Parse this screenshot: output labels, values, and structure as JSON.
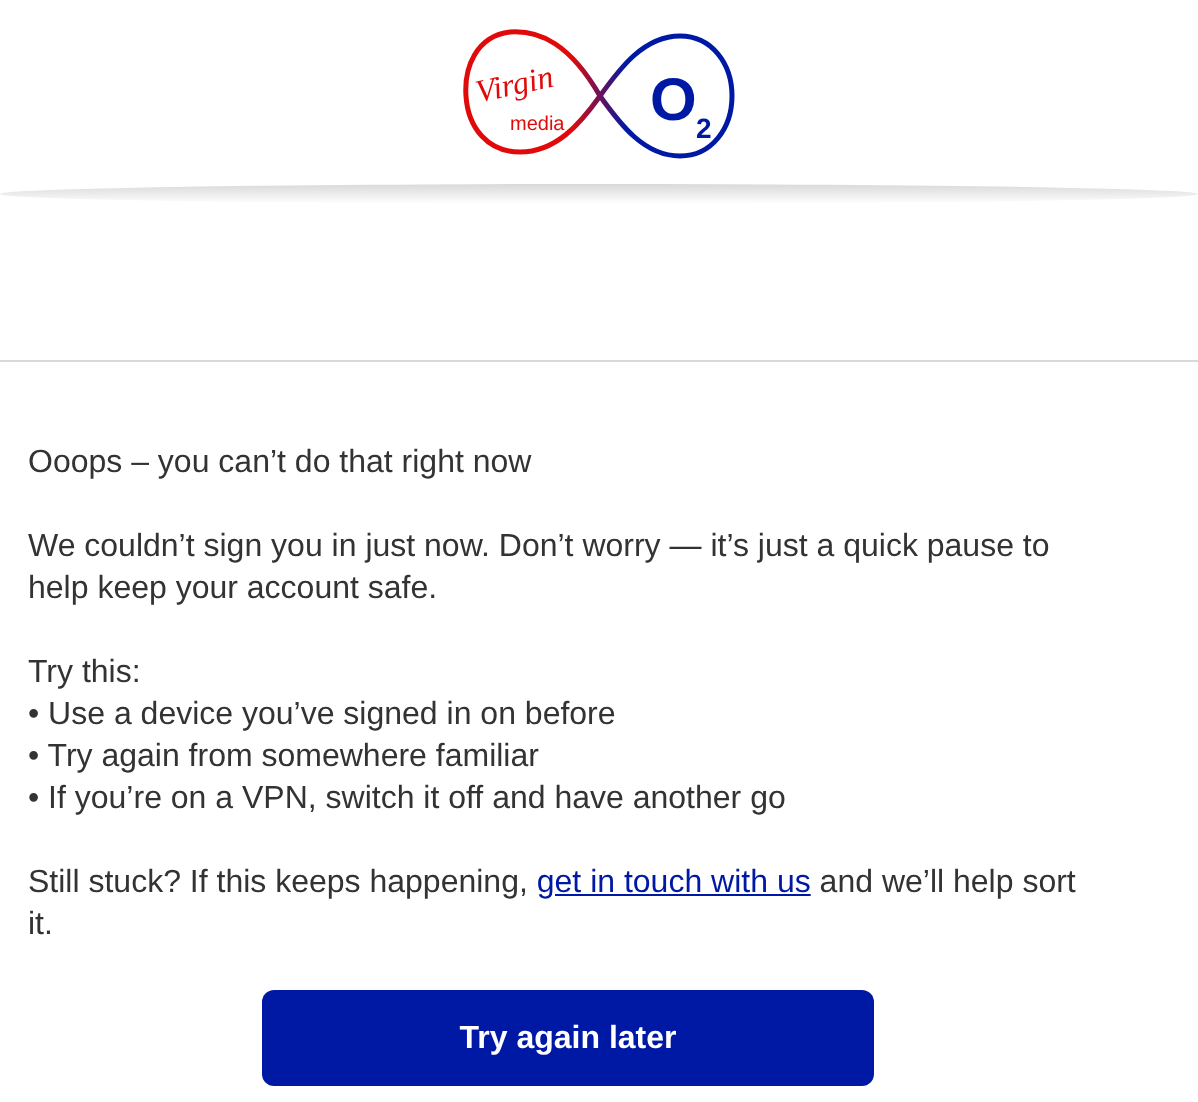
{
  "logo": {
    "left_line_1": "Virgin",
    "left_line_2": "media",
    "right_letter": "O",
    "right_subscript": "2"
  },
  "heading": "Ooops – you can’t do that right now",
  "message": "We couldn’t sign you in just now. Don’t worry — it’s just a quick pause to help keep your account safe.",
  "tips_title": "Try this:",
  "tips": [
    "• Use a device you’ve signed in on before",
    "• Try again from somewhere familiar",
    "• If you’re on a VPN, switch it off and have another go"
  ],
  "help": {
    "before": "Still stuck? If this keeps happening,",
    "link": "get in touch with us",
    "after": "and we’ll help sort it."
  },
  "button": "Try again later"
}
